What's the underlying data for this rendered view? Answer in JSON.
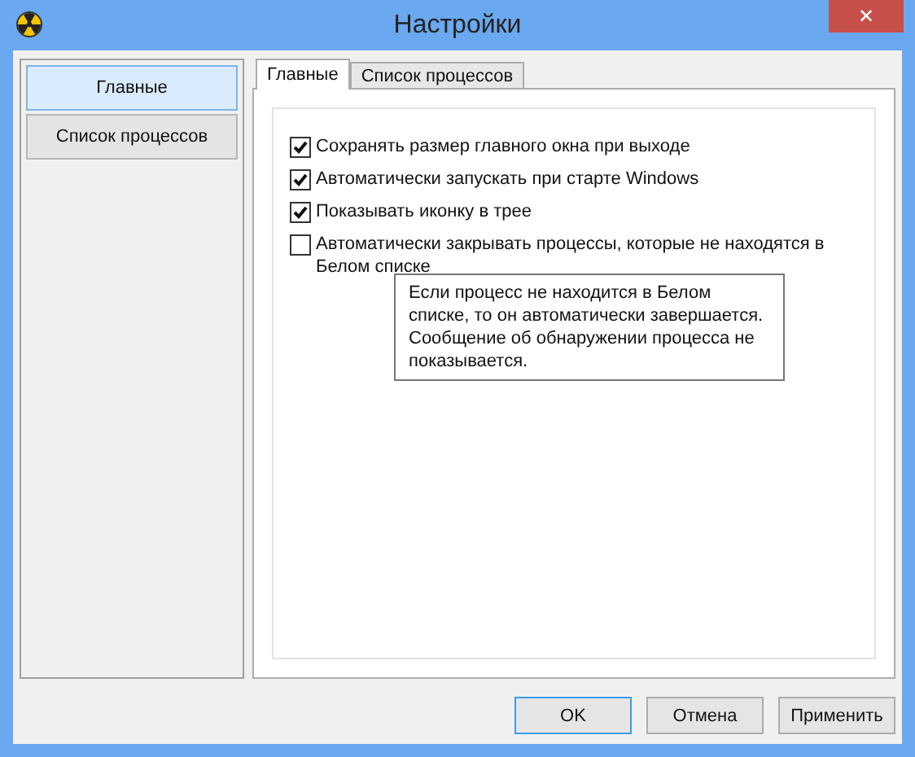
{
  "window": {
    "title": "Настройки",
    "close": "✕"
  },
  "sidebar": {
    "items": [
      {
        "label": "Главные",
        "selected": true
      },
      {
        "label": "Список процессов",
        "selected": false
      }
    ]
  },
  "tabs": [
    {
      "label": "Главные",
      "selected": true
    },
    {
      "label": "Список процессов",
      "selected": false
    }
  ],
  "options": [
    {
      "label": "Сохранять размер главного окна при выходе",
      "checked": true
    },
    {
      "label": "Автоматически запускать при старте Windows",
      "checked": true
    },
    {
      "label": "Показывать иконку в трее",
      "checked": true
    },
    {
      "label": "Автоматически закрывать процессы, которые не находятся в Белом списке",
      "checked": false
    }
  ],
  "tooltip": "Если процесс не находится в Белом списке, то он автоматически завершается. Сообщение об обнаружении процесса не показывается.",
  "buttons": [
    {
      "label": "OK",
      "default": true
    },
    {
      "label": "Отмена",
      "default": false
    },
    {
      "label": "Применить",
      "default": false
    }
  ]
}
